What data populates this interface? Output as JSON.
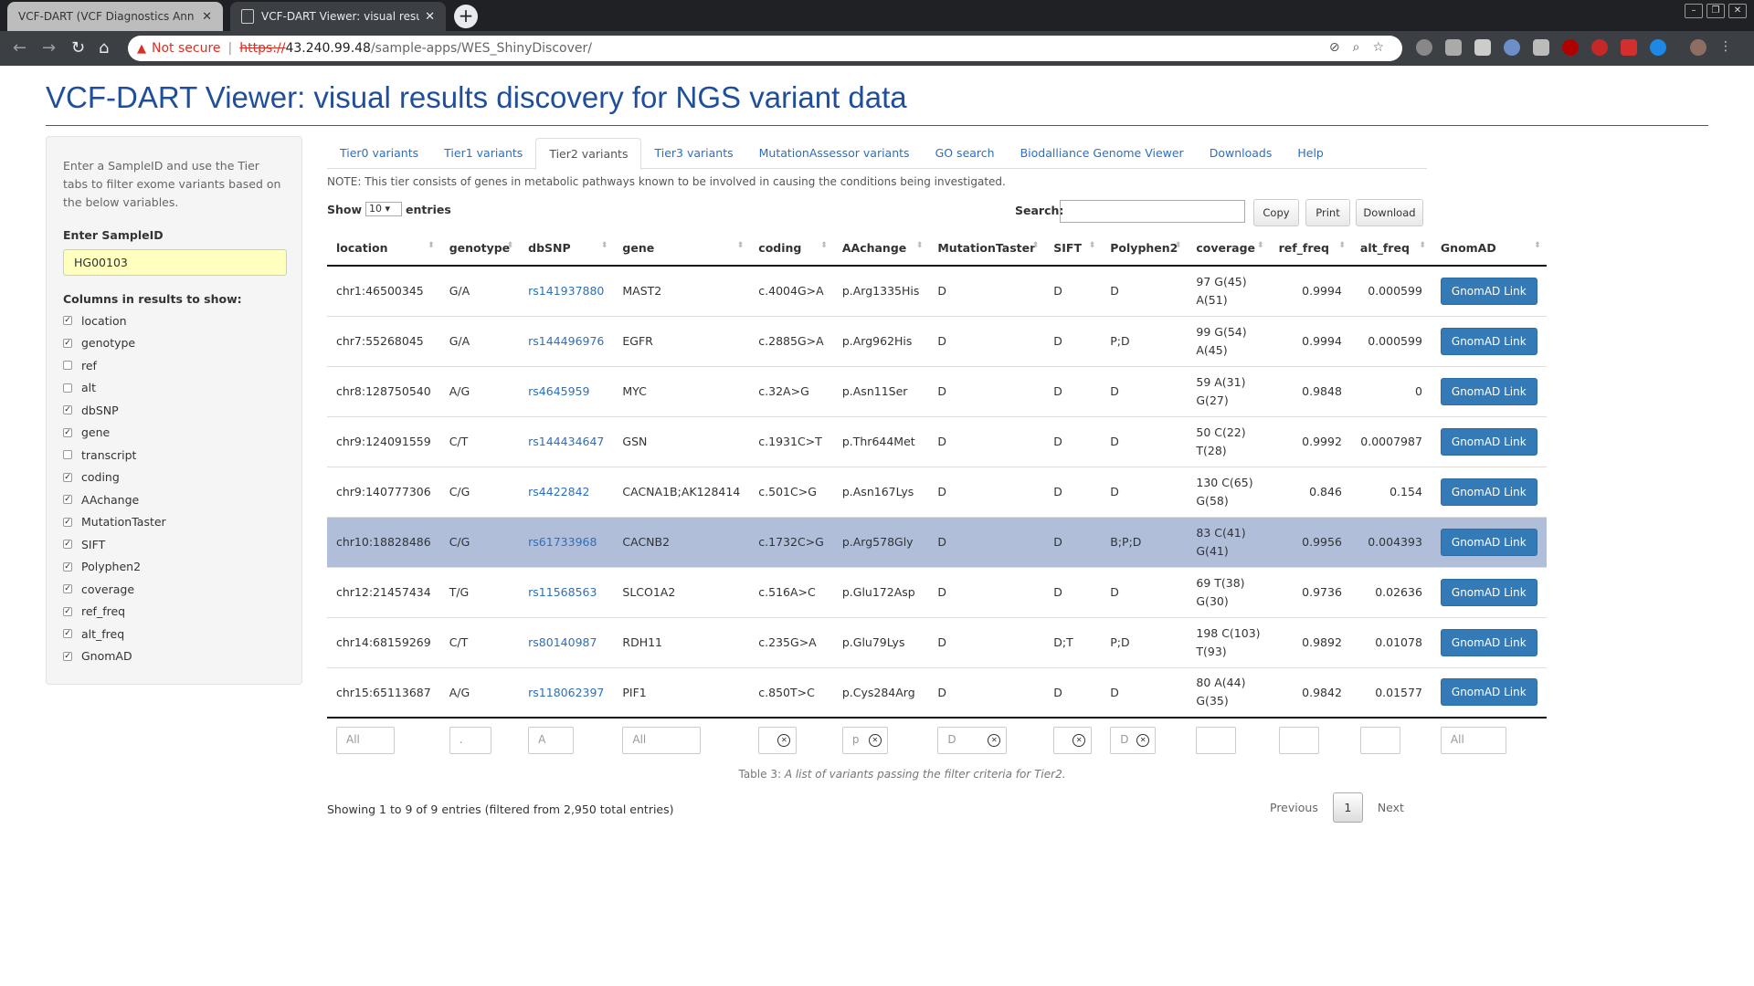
{
  "browser": {
    "tabs": [
      {
        "title": "VCF-DART (VCF Diagnostics Ann",
        "active": false
      },
      {
        "title": "VCF-DART Viewer: visual results d",
        "active": true
      }
    ],
    "new_tab": "+",
    "security": "Not secure",
    "url_scheme": "https://",
    "url_host": "43.240.99.48",
    "url_path": "/sample-apps/WES_ShinyDiscover/",
    "window_controls": [
      "–",
      "❐",
      "✕"
    ]
  },
  "page": {
    "title": "VCF-DART Viewer: visual results discovery for NGS variant data"
  },
  "sidebar": {
    "intro": "Enter a SampleID and use the Tier tabs to filter exome variants based on the below variables.",
    "sample_label": "Enter SampleID",
    "sample_value": "HG00103",
    "columns_label": "Columns in results to show:",
    "columns": [
      {
        "label": "location",
        "checked": true
      },
      {
        "label": "genotype",
        "checked": true
      },
      {
        "label": "ref",
        "checked": false
      },
      {
        "label": "alt",
        "checked": false
      },
      {
        "label": "dbSNP",
        "checked": true
      },
      {
        "label": "gene",
        "checked": true
      },
      {
        "label": "transcript",
        "checked": false
      },
      {
        "label": "coding",
        "checked": true
      },
      {
        "label": "AAchange",
        "checked": true
      },
      {
        "label": "MutationTaster",
        "checked": true
      },
      {
        "label": "SIFT",
        "checked": true
      },
      {
        "label": "Polyphen2",
        "checked": true
      },
      {
        "label": "coverage",
        "checked": true
      },
      {
        "label": "ref_freq",
        "checked": true
      },
      {
        "label": "alt_freq",
        "checked": true
      },
      {
        "label": "GnomAD",
        "checked": true
      }
    ]
  },
  "tabs": [
    "Tier0 variants",
    "Tier1 variants",
    "Tier2 variants",
    "Tier3 variants",
    "MutationAssessor variants",
    "GO search",
    "Biodalliance Genome Viewer",
    "Downloads",
    "Help"
  ],
  "active_tab": "Tier2 variants",
  "note": "NOTE: This tier consists of genes in metabolic pathways known to be involved in causing the conditions being investigated.",
  "controls": {
    "show_label": "Show",
    "entries_value": "10",
    "entries_label": "entries",
    "search_label": "Search:",
    "copy": "Copy",
    "print": "Print",
    "download": "Download"
  },
  "table": {
    "headers": [
      "location",
      "genotype",
      "dbSNP",
      "gene",
      "coding",
      "AAchange",
      "MutationTaster",
      "SIFT",
      "Polyphen2",
      "coverage",
      "ref_freq",
      "alt_freq",
      "GnomAD"
    ],
    "rows": [
      {
        "location": "chr1:46500345",
        "genotype": "G/A",
        "dbSNP": "rs141937880",
        "gene": "MAST2",
        "coding": "c.4004G>A",
        "aa": "p.Arg1335His",
        "mt": "D",
        "sift": "D",
        "pp2": "D",
        "cov1": "97 G(45)",
        "cov2": "A(51)",
        "ref_freq": "0.9994",
        "alt_freq": "0.000599",
        "gnomad": "GnomAD Link"
      },
      {
        "location": "chr7:55268045",
        "genotype": "G/A",
        "dbSNP": "rs144496976",
        "gene": "EGFR",
        "coding": "c.2885G>A",
        "aa": "p.Arg962His",
        "mt": "D",
        "sift": "D",
        "pp2": "P;D",
        "cov1": "99 G(54)",
        "cov2": "A(45)",
        "ref_freq": "0.9994",
        "alt_freq": "0.000599",
        "gnomad": "GnomAD Link"
      },
      {
        "location": "chr8:128750540",
        "genotype": "A/G",
        "dbSNP": "rs4645959",
        "gene": "MYC",
        "coding": "c.32A>G",
        "aa": "p.Asn11Ser",
        "mt": "D",
        "sift": "D",
        "pp2": "D",
        "cov1": "59 A(31)",
        "cov2": "G(27)",
        "ref_freq": "0.9848",
        "alt_freq": "0",
        "gnomad": "GnomAD Link"
      },
      {
        "location": "chr9:124091559",
        "genotype": "C/T",
        "dbSNP": "rs144434647",
        "gene": "GSN",
        "coding": "c.1931C>T",
        "aa": "p.Thr644Met",
        "mt": "D",
        "sift": "D",
        "pp2": "D",
        "cov1": "50 C(22)",
        "cov2": "T(28)",
        "ref_freq": "0.9992",
        "alt_freq": "0.0007987",
        "gnomad": "GnomAD Link"
      },
      {
        "location": "chr9:140777306",
        "genotype": "C/G",
        "dbSNP": "rs4422842",
        "gene": "CACNA1B;AK128414",
        "coding": "c.501C>G",
        "aa": "p.Asn167Lys",
        "mt": "D",
        "sift": "D",
        "pp2": "D",
        "cov1": "130 C(65)",
        "cov2": "G(58)",
        "ref_freq": "0.846",
        "alt_freq": "0.154",
        "gnomad": "GnomAD Link"
      },
      {
        "location": "chr10:18828486",
        "genotype": "C/G",
        "dbSNP": "rs61733968",
        "gene": "CACNB2",
        "coding": "c.1732C>G",
        "aa": "p.Arg578Gly",
        "mt": "D",
        "sift": "D",
        "pp2": "B;P;D",
        "cov1": "83 C(41)",
        "cov2": "G(41)",
        "ref_freq": "0.9956",
        "alt_freq": "0.004393",
        "gnomad": "GnomAD Link",
        "selected": true
      },
      {
        "location": "chr12:21457434",
        "genotype": "T/G",
        "dbSNP": "rs11568563",
        "gene": "SLCO1A2",
        "coding": "c.516A>C",
        "aa": "p.Glu172Asp",
        "mt": "D",
        "sift": "D",
        "pp2": "D",
        "cov1": "69 T(38)",
        "cov2": "G(30)",
        "ref_freq": "0.9736",
        "alt_freq": "0.02636",
        "gnomad": "GnomAD Link"
      },
      {
        "location": "chr14:68159269",
        "genotype": "C/T",
        "dbSNP": "rs80140987",
        "gene": "RDH11",
        "coding": "c.235G>A",
        "aa": "p.Glu79Lys",
        "mt": "D",
        "sift": "D;T",
        "pp2": "P;D",
        "cov1": "198 C(103)",
        "cov2": "T(93)",
        "ref_freq": "0.9892",
        "alt_freq": "0.01078",
        "gnomad": "GnomAD Link"
      },
      {
        "location": "chr15:65113687",
        "genotype": "A/G",
        "dbSNP": "rs118062397",
        "gene": "PIF1",
        "coding": "c.850T>C",
        "aa": "p.Cys284Arg",
        "mt": "D",
        "sift": "D",
        "pp2": "D",
        "cov1": "80 A(44)",
        "cov2": "G(35)",
        "ref_freq": "0.9842",
        "alt_freq": "0.01577",
        "gnomad": "GnomAD Link"
      }
    ],
    "filters": [
      "All",
      ".",
      "A",
      "All",
      "",
      "p",
      "D",
      "",
      "D",
      "",
      "",
      "",
      "All"
    ]
  },
  "caption_prefix": "Table 3: ",
  "caption_text": "A list of variants passing the filter criteria for Tier2.",
  "info": "Showing 1 to 9 of 9 entries (filtered from 2,950 total entries)",
  "pager": {
    "previous": "Previous",
    "page": "1",
    "next": "Next"
  }
}
